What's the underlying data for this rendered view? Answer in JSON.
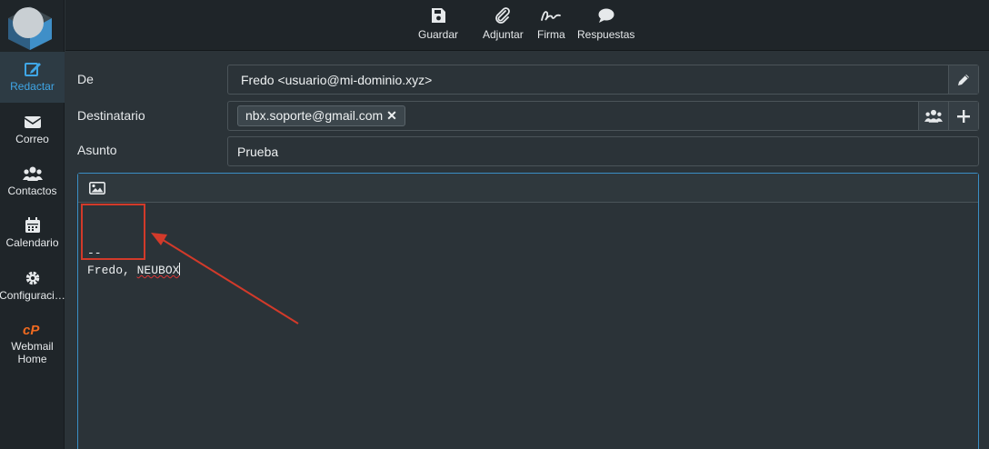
{
  "sidebar": {
    "items": [
      {
        "label": "Redactar",
        "icon": "compose-icon",
        "active": true
      },
      {
        "label": "Correo",
        "icon": "envelope-icon"
      },
      {
        "label": "Contactos",
        "icon": "contacts-icon"
      },
      {
        "label": "Calendario",
        "icon": "calendar-icon"
      },
      {
        "label": "Configuraci…",
        "icon": "gear-icon"
      },
      {
        "label": "Webmail",
        "label2": "Home",
        "icon": "cpanel-icon"
      }
    ]
  },
  "toolbar": {
    "save_label": "Guardar",
    "attach_label": "Adjuntar",
    "signature_label": "Firma",
    "responses_label": "Respuestas"
  },
  "form": {
    "from_label": "De",
    "from_value": "Fredo <usuario@mi-dominio.xyz>",
    "to_label": "Destinatario",
    "to_recipient": "nbx.soporte@gmail.com",
    "subject_label": "Asunto",
    "subject_value": "Prueba"
  },
  "editor": {
    "separator": "--",
    "signature_name": "Fredo, ",
    "signature_company": "NEUBOX"
  },
  "colors": {
    "accent": "#3fa6e6",
    "annotation": "#d23a2a",
    "cpanel_orange": "#f06a20"
  }
}
